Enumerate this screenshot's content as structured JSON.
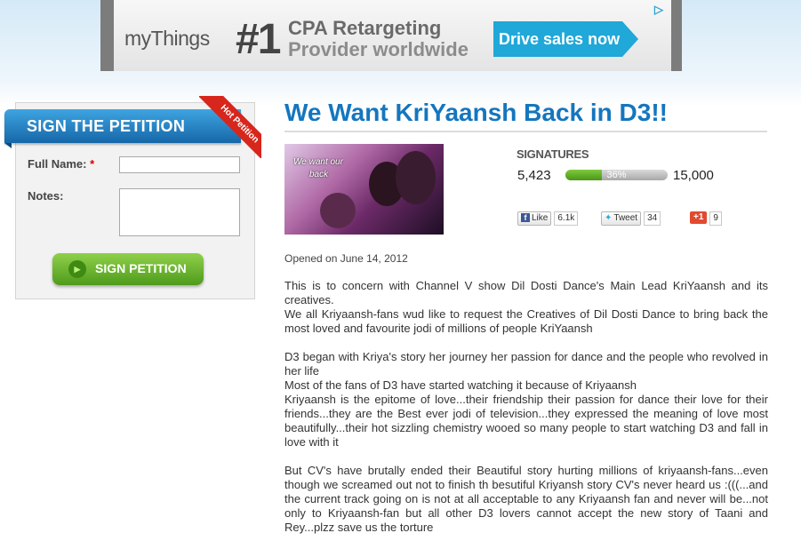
{
  "ad": {
    "logo": "myThings",
    "headline_num": "#1",
    "headline_line1": "CPA Retargeting",
    "headline_line2": "Provider worldwide",
    "cta": "Drive sales now",
    "choice_icon": "adchoices-icon"
  },
  "sidebar": {
    "ribbon": "SIGN THE PETITION",
    "hot_badge": "Hot Petition",
    "full_name_label": "Full Name:",
    "required_mark": "*",
    "full_name_value": "",
    "notes_label": "Notes:",
    "notes_value": "",
    "sign_button": "SIGN PETITION"
  },
  "petition": {
    "title": "We Want KriYaansh Back in D3!!",
    "thumb_caption_line1": "We want our",
    "thumb_caption_line2": "back",
    "signatures_heading": "SIGNATURES",
    "signatures_count": "5,423",
    "progress_percent": 36,
    "progress_label": "36%",
    "signatures_goal": "15,000",
    "social": {
      "fb_label": "Like",
      "fb_count": "6.1k",
      "tw_label": "Tweet",
      "tw_count": "34",
      "gplus_label": "+1",
      "gplus_count": "9"
    },
    "opened": "Opened on June 14, 2012",
    "paragraphs": [
      "This is to concern with Channel V show Dil Dosti Dance's Main Lead KriYaansh and its creatives.",
      "We all Kriyaansh-fans wud like to request the Creatives of Dil Dosti Dance to bring back the most loved and favourite jodi of millions of people KriYaansh",
      "",
      "D3 began with Kriya's story her journey her passion for dance and the people who revolved in her life",
      "Most of the fans of D3 have started watching it because of Kriyaansh",
      "Kriyaansh is the epitome of love...their friendship their passion for dance their love for their friends...they are the Best ever jodi of television...they expressed the meaning of love most beautifully...their hot sizzling chemistry wooed so many people to start watching D3 and fall in love with it",
      "",
      "But CV's have brutally ended their Beautiful story hurting millions of kriyaansh-fans...even though we screamed out not to finish th besutiful Kriyansh story CV's never heard us :(((...and the current track going on is not at all acceptable to any Kriyaansh fan and never will be...not only to Kriyaansh-fan but all other D3 lovers cannot accept the new story of Taani and Rey...plzz save us the torture"
    ]
  },
  "colors": {
    "title": "#1476be",
    "ribbon": "#1f7fc6",
    "hot": "#d7261c",
    "progress": "#5cae24",
    "cta": "#1fa8d8"
  }
}
